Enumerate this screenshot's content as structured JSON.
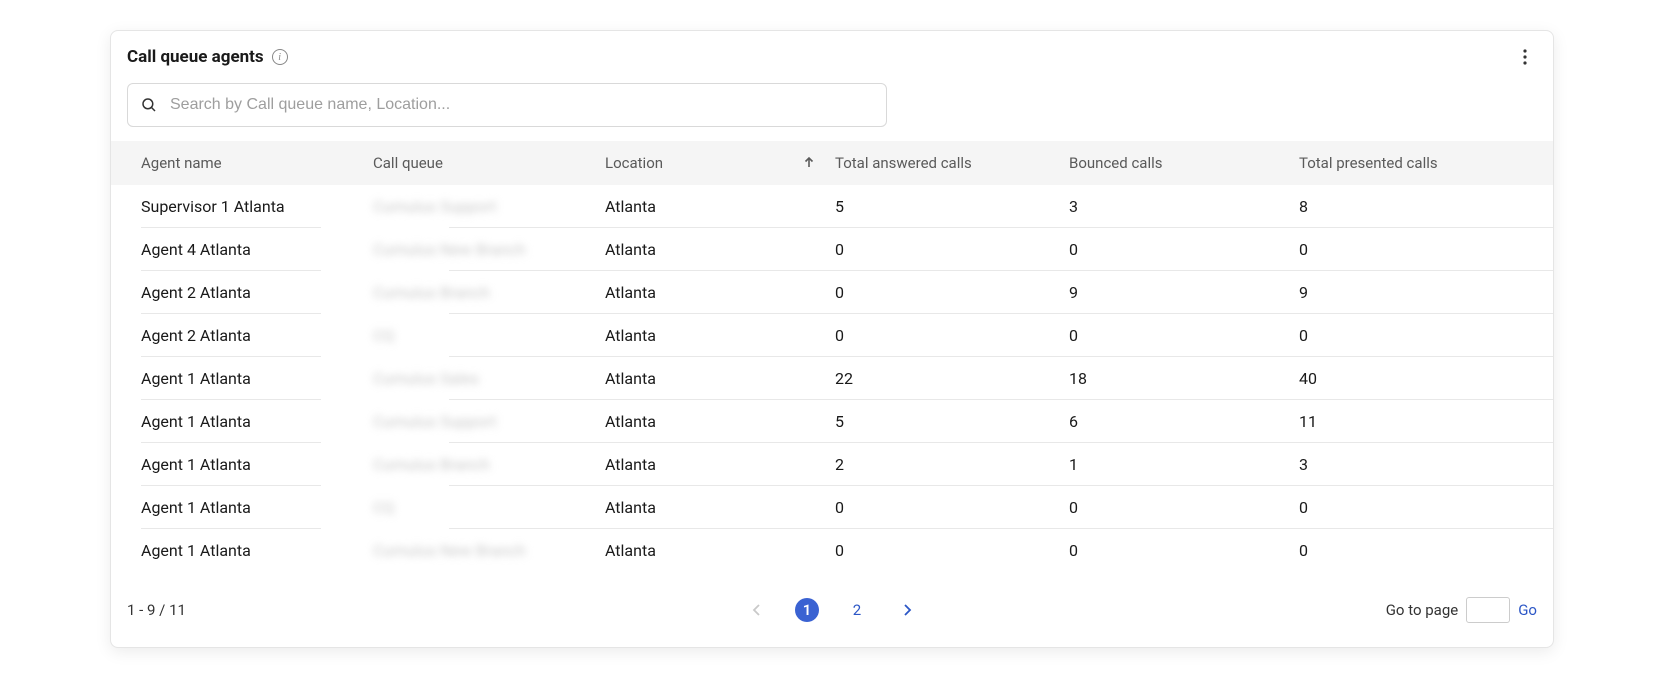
{
  "header": {
    "title": "Call queue agents"
  },
  "search": {
    "placeholder": "Search by Call queue name, Location..."
  },
  "columns": {
    "agent": "Agent name",
    "queue": "Call queue",
    "location": "Location",
    "answered": "Total answered calls",
    "bounced": "Bounced calls",
    "presented": "Total presented calls"
  },
  "rows": [
    {
      "agent": "Supervisor 1 Atlanta",
      "queue": "Cumulus Support",
      "location": "Atlanta",
      "answered": "5",
      "bounced": "3",
      "presented": "8"
    },
    {
      "agent": "Agent 4 Atlanta",
      "queue": "Cumulus New Branch",
      "location": "Atlanta",
      "answered": "0",
      "bounced": "0",
      "presented": "0"
    },
    {
      "agent": "Agent 2 Atlanta",
      "queue": "Cumulus Branch",
      "location": "Atlanta",
      "answered": "0",
      "bounced": "9",
      "presented": "9"
    },
    {
      "agent": "Agent 2 Atlanta",
      "queue": "CQ",
      "location": "Atlanta",
      "answered": "0",
      "bounced": "0",
      "presented": "0"
    },
    {
      "agent": "Agent 1 Atlanta",
      "queue": "Cumulus Sales",
      "location": "Atlanta",
      "answered": "22",
      "bounced": "18",
      "presented": "40"
    },
    {
      "agent": "Agent 1 Atlanta",
      "queue": "Cumulus Support",
      "location": "Atlanta",
      "answered": "5",
      "bounced": "6",
      "presented": "11"
    },
    {
      "agent": "Agent 1 Atlanta",
      "queue": "Cumulus Branch",
      "location": "Atlanta",
      "answered": "2",
      "bounced": "1",
      "presented": "3"
    },
    {
      "agent": "Agent 1 Atlanta",
      "queue": "CQ",
      "location": "Atlanta",
      "answered": "0",
      "bounced": "0",
      "presented": "0"
    },
    {
      "agent": "Agent 1 Atlanta",
      "queue": "Cumulus New Branch",
      "location": "Atlanta",
      "answered": "0",
      "bounced": "0",
      "presented": "0"
    }
  ],
  "pagination": {
    "range": "1 - 9 / 11",
    "pages": [
      "1",
      "2"
    ],
    "current": "1",
    "goto_label": "Go to page",
    "go_label": "Go"
  }
}
